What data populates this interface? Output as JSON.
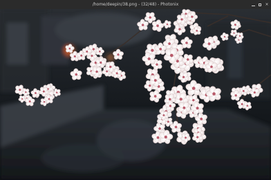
{
  "window": {
    "title": "/home/deepin/38.png - (32/48) - Photonix"
  },
  "controls": {
    "minimize_icon": "minimize-icon",
    "maximize_icon": "maximize-icon",
    "close_icon": "close-icon",
    "close_glyph": "×"
  },
  "image": {
    "subject": "cherry-blossom-photo"
  }
}
